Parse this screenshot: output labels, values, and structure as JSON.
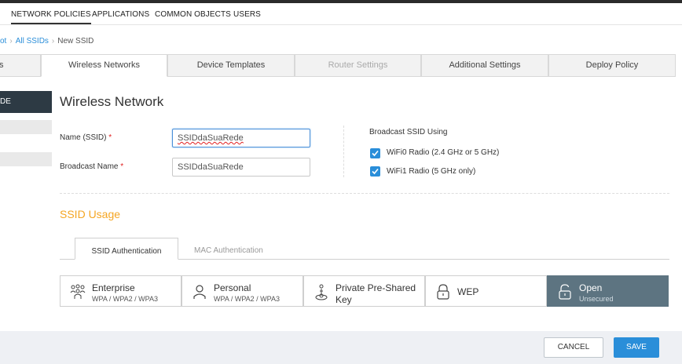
{
  "top_nav": {
    "items": [
      "NETWORK POLICIES",
      "APPLICATIONS",
      "COMMON OBJECTS",
      "USERS"
    ],
    "active": "NETWORK POLICIES"
  },
  "breadcrumb": {
    "items": [
      "ot",
      "All SSIDs",
      "New SSID"
    ]
  },
  "tabs": [
    {
      "label": "s"
    },
    {
      "label": "Wireless Networks",
      "active": true
    },
    {
      "label": "Device Templates"
    },
    {
      "label": "Router Settings",
      "disabled": true
    },
    {
      "label": "Additional Settings"
    },
    {
      "label": "Deploy Policy"
    }
  ],
  "sidebar": {
    "first_label": "DE"
  },
  "form": {
    "title": "Wireless Network",
    "name_label": "Name (SSID)",
    "name_value": "SSIDdaSuaRede",
    "broadcast_label": "Broadcast Name",
    "broadcast_value": "SSIDdaSuaRede",
    "required_mark": "*",
    "broadcast_using_label": "Broadcast SSID Using",
    "radios": [
      {
        "label": "WiFi0 Radio (2.4 GHz or 5 GHz)",
        "checked": true
      },
      {
        "label": "WiFi1 Radio (5 GHz only)",
        "checked": true
      }
    ]
  },
  "ssid_usage": {
    "title": "SSID Usage",
    "auth_tabs": [
      {
        "label": "SSID Authentication",
        "active": true
      },
      {
        "label": "MAC Authentication"
      }
    ],
    "options": [
      {
        "icon": "enterprise-icon",
        "title": "Enterprise",
        "subtitle": "WPA / WPA2 / WPA3"
      },
      {
        "icon": "person-icon",
        "title": "Personal",
        "subtitle": "WPA / WPA2 / WPA3"
      },
      {
        "icon": "key-person-icon",
        "title": "Private Pre-Shared",
        "subtitle": "Key"
      },
      {
        "icon": "lock-icon",
        "title": "WEP",
        "subtitle": ""
      },
      {
        "icon": "unlock-icon",
        "title": "Open",
        "subtitle": "Unsecured",
        "selected": true
      }
    ]
  },
  "footer": {
    "cancel_label": "CANCEL",
    "save_label": "SAVE"
  },
  "colors": {
    "accent": "#2a8ed9",
    "section_title": "#f5a623",
    "selected_option": "#5d7481",
    "sidebar_dark": "#2d3a44",
    "required": "#e02020"
  }
}
